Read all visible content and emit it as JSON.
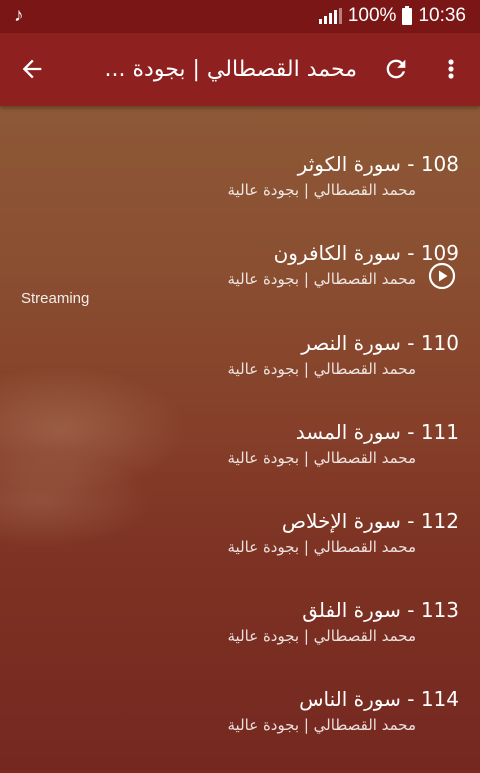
{
  "status_bar": {
    "icon_left": "music-note-icon",
    "battery_percent": "100%",
    "time": "10:36"
  },
  "app_bar": {
    "title": "محمد القصطالي | بجودة ...",
    "back_icon": "arrow-back-icon",
    "refresh_icon": "refresh-icon",
    "menu_icon": "more-vert-icon"
  },
  "player": {
    "status_label": "Streaming",
    "play_icon": "play-circle-icon"
  },
  "tracks": [
    {
      "name": "108 - سورة الكوثر",
      "artist": "محمد القصطالي | بجودة عالية"
    },
    {
      "name": "109 - سورة الكافرون",
      "artist": "محمد القصطالي | بجودة عالية"
    },
    {
      "name": "110 - سورة النصر",
      "artist": "محمد القصطالي | بجودة عالية"
    },
    {
      "name": "111 - سورة المسد",
      "artist": "محمد القصطالي | بجودة عالية"
    },
    {
      "name": "112 - سورة الإخلاص",
      "artist": "محمد القصطالي | بجودة عالية"
    },
    {
      "name": "113 - سورة الفلق",
      "artist": "محمد القصطالي | بجودة عالية"
    },
    {
      "name": "114 - سورة الناس",
      "artist": "محمد القصطالي | بجودة عالية"
    }
  ]
}
